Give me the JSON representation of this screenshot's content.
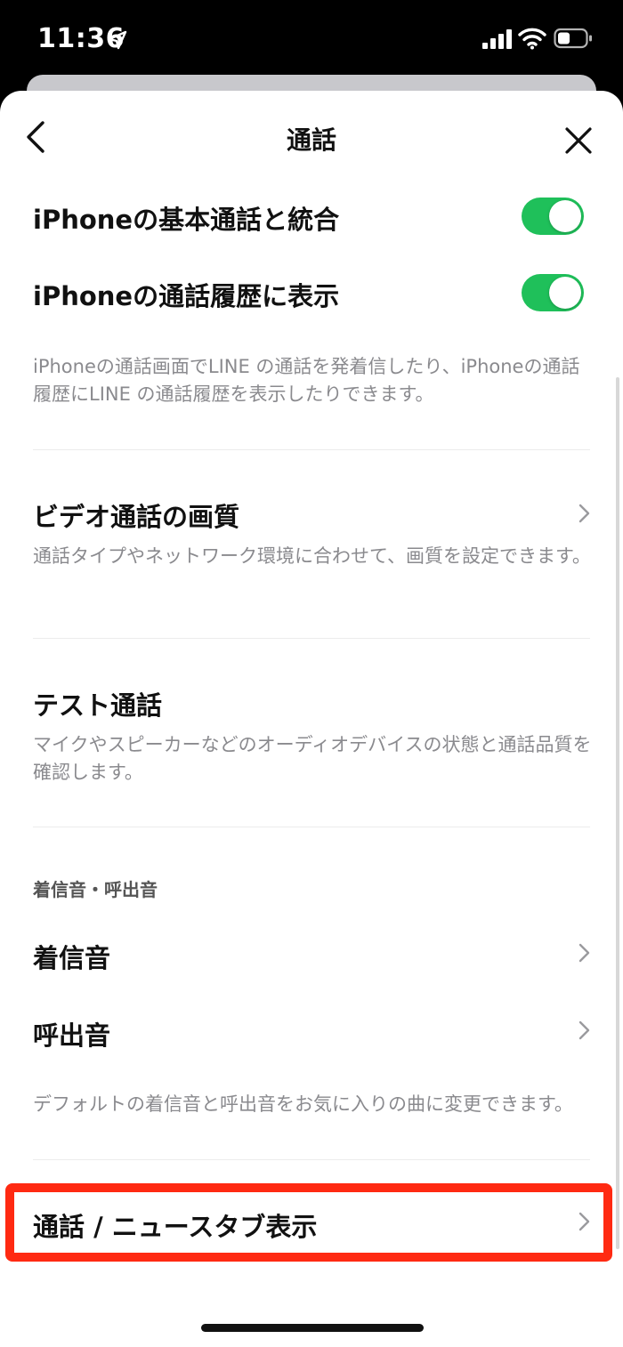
{
  "status_bar": {
    "time": "11:36"
  },
  "nav": {
    "title": "通話"
  },
  "items": {
    "native_call": {
      "label": "iPhoneの基本通話と統合",
      "on": true
    },
    "call_history": {
      "label": "iPhoneの通話履歴に表示",
      "on": true
    },
    "integration_desc": "iPhoneの通話画面でLINE の通話を発着信したり、iPhoneの通話履歴にLINE の通話履歴を表示したりできます。",
    "video_quality": {
      "label": "ビデオ通話の画質",
      "desc": "通話タイプやネットワーク環境に合わせて、画質を設定できます。"
    },
    "test_call": {
      "label": "テスト通話",
      "desc": "マイクやスピーカーなどのオーディオデバイスの状態と通話品質を確認します。"
    },
    "ringtone_section": {
      "header": "着信音・呼出音"
    },
    "ringtone": {
      "label": "着信音"
    },
    "ringback": {
      "label": "呼出音"
    },
    "ringtone_desc": "デフォルトの着信音と呼出音をお気に入りの曲に変更できます。",
    "call_news_tab": {
      "label": "通話 / ニュースタブ表示"
    }
  },
  "colors": {
    "toggle_on": "#1fc05a",
    "highlight": "#ff2a12"
  }
}
